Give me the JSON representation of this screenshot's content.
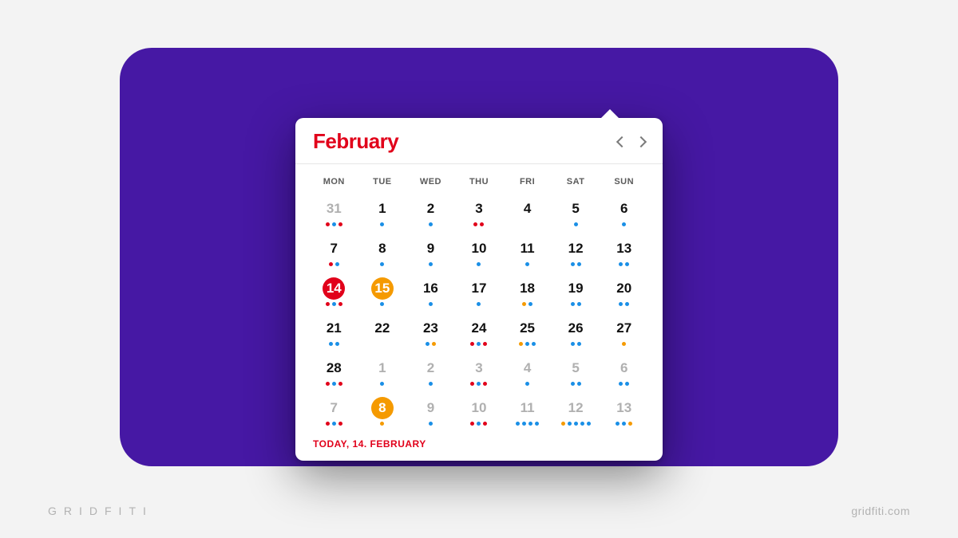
{
  "brand": {
    "left": "GRIDFITI",
    "right": "gridfiti.com"
  },
  "calendar": {
    "title": "February",
    "footer": "TODAY, 14. FEBRUARY",
    "dow": [
      "MON",
      "TUE",
      "WED",
      "THU",
      "FRI",
      "SAT",
      "SUN"
    ],
    "colors": {
      "red": "#e1001a",
      "blue": "#1a8fe6",
      "orange": "#f59a00",
      "accent_bg": "#4618a4"
    },
    "days": [
      {
        "n": 31,
        "muted": true,
        "dots": [
          "r",
          "b",
          "r"
        ]
      },
      {
        "n": 1,
        "dots": [
          "b"
        ]
      },
      {
        "n": 2,
        "dots": [
          "b"
        ]
      },
      {
        "n": 3,
        "dots": [
          "r",
          "r"
        ]
      },
      {
        "n": 4,
        "dots": []
      },
      {
        "n": 5,
        "dots": [
          "b"
        ]
      },
      {
        "n": 6,
        "dots": [
          "b"
        ]
      },
      {
        "n": 7,
        "dots": [
          "r",
          "b"
        ]
      },
      {
        "n": 8,
        "dots": [
          "b"
        ]
      },
      {
        "n": 9,
        "dots": [
          "b"
        ]
      },
      {
        "n": 10,
        "dots": [
          "b"
        ]
      },
      {
        "n": 11,
        "dots": [
          "b"
        ]
      },
      {
        "n": 12,
        "dots": [
          "b",
          "b"
        ]
      },
      {
        "n": 13,
        "dots": [
          "b",
          "b"
        ]
      },
      {
        "n": 14,
        "today": true,
        "dots": [
          "r",
          "b",
          "r"
        ]
      },
      {
        "n": 15,
        "sel": true,
        "dots": [
          "b"
        ]
      },
      {
        "n": 16,
        "dots": [
          "b"
        ]
      },
      {
        "n": 17,
        "dots": [
          "b"
        ]
      },
      {
        "n": 18,
        "dots": [
          "o",
          "b"
        ]
      },
      {
        "n": 19,
        "dots": [
          "b",
          "b"
        ]
      },
      {
        "n": 20,
        "dots": [
          "b",
          "b"
        ]
      },
      {
        "n": 21,
        "dots": [
          "b",
          "b"
        ]
      },
      {
        "n": 22,
        "dots": []
      },
      {
        "n": 23,
        "dots": [
          "b",
          "o"
        ]
      },
      {
        "n": 24,
        "dots": [
          "r",
          "b",
          "r"
        ]
      },
      {
        "n": 25,
        "dots": [
          "o",
          "b",
          "b"
        ]
      },
      {
        "n": 26,
        "dots": [
          "b",
          "b"
        ]
      },
      {
        "n": 27,
        "dots": [
          "o"
        ]
      },
      {
        "n": 28,
        "dots": [
          "r",
          "b",
          "r"
        ]
      },
      {
        "n": 1,
        "muted": true,
        "dots": [
          "b"
        ]
      },
      {
        "n": 2,
        "muted": true,
        "dots": [
          "b"
        ]
      },
      {
        "n": 3,
        "muted": true,
        "dots": [
          "r",
          "b",
          "r"
        ]
      },
      {
        "n": 4,
        "muted": true,
        "dots": [
          "b"
        ]
      },
      {
        "n": 5,
        "muted": true,
        "dots": [
          "b",
          "b"
        ]
      },
      {
        "n": 6,
        "muted": true,
        "dots": [
          "b",
          "b"
        ]
      },
      {
        "n": 7,
        "muted": true,
        "dots": [
          "r",
          "b",
          "r"
        ]
      },
      {
        "n": 8,
        "muted": true,
        "sel": true,
        "dots": [
          "o"
        ]
      },
      {
        "n": 9,
        "muted": true,
        "dots": [
          "b"
        ]
      },
      {
        "n": 10,
        "muted": true,
        "dots": [
          "r",
          "b",
          "r"
        ]
      },
      {
        "n": 11,
        "muted": true,
        "dots": [
          "b",
          "b",
          "b",
          "b"
        ]
      },
      {
        "n": 12,
        "muted": true,
        "dots": [
          "o",
          "b",
          "b",
          "b",
          "b"
        ]
      },
      {
        "n": 13,
        "muted": true,
        "dots": [
          "b",
          "b",
          "o"
        ]
      }
    ]
  }
}
